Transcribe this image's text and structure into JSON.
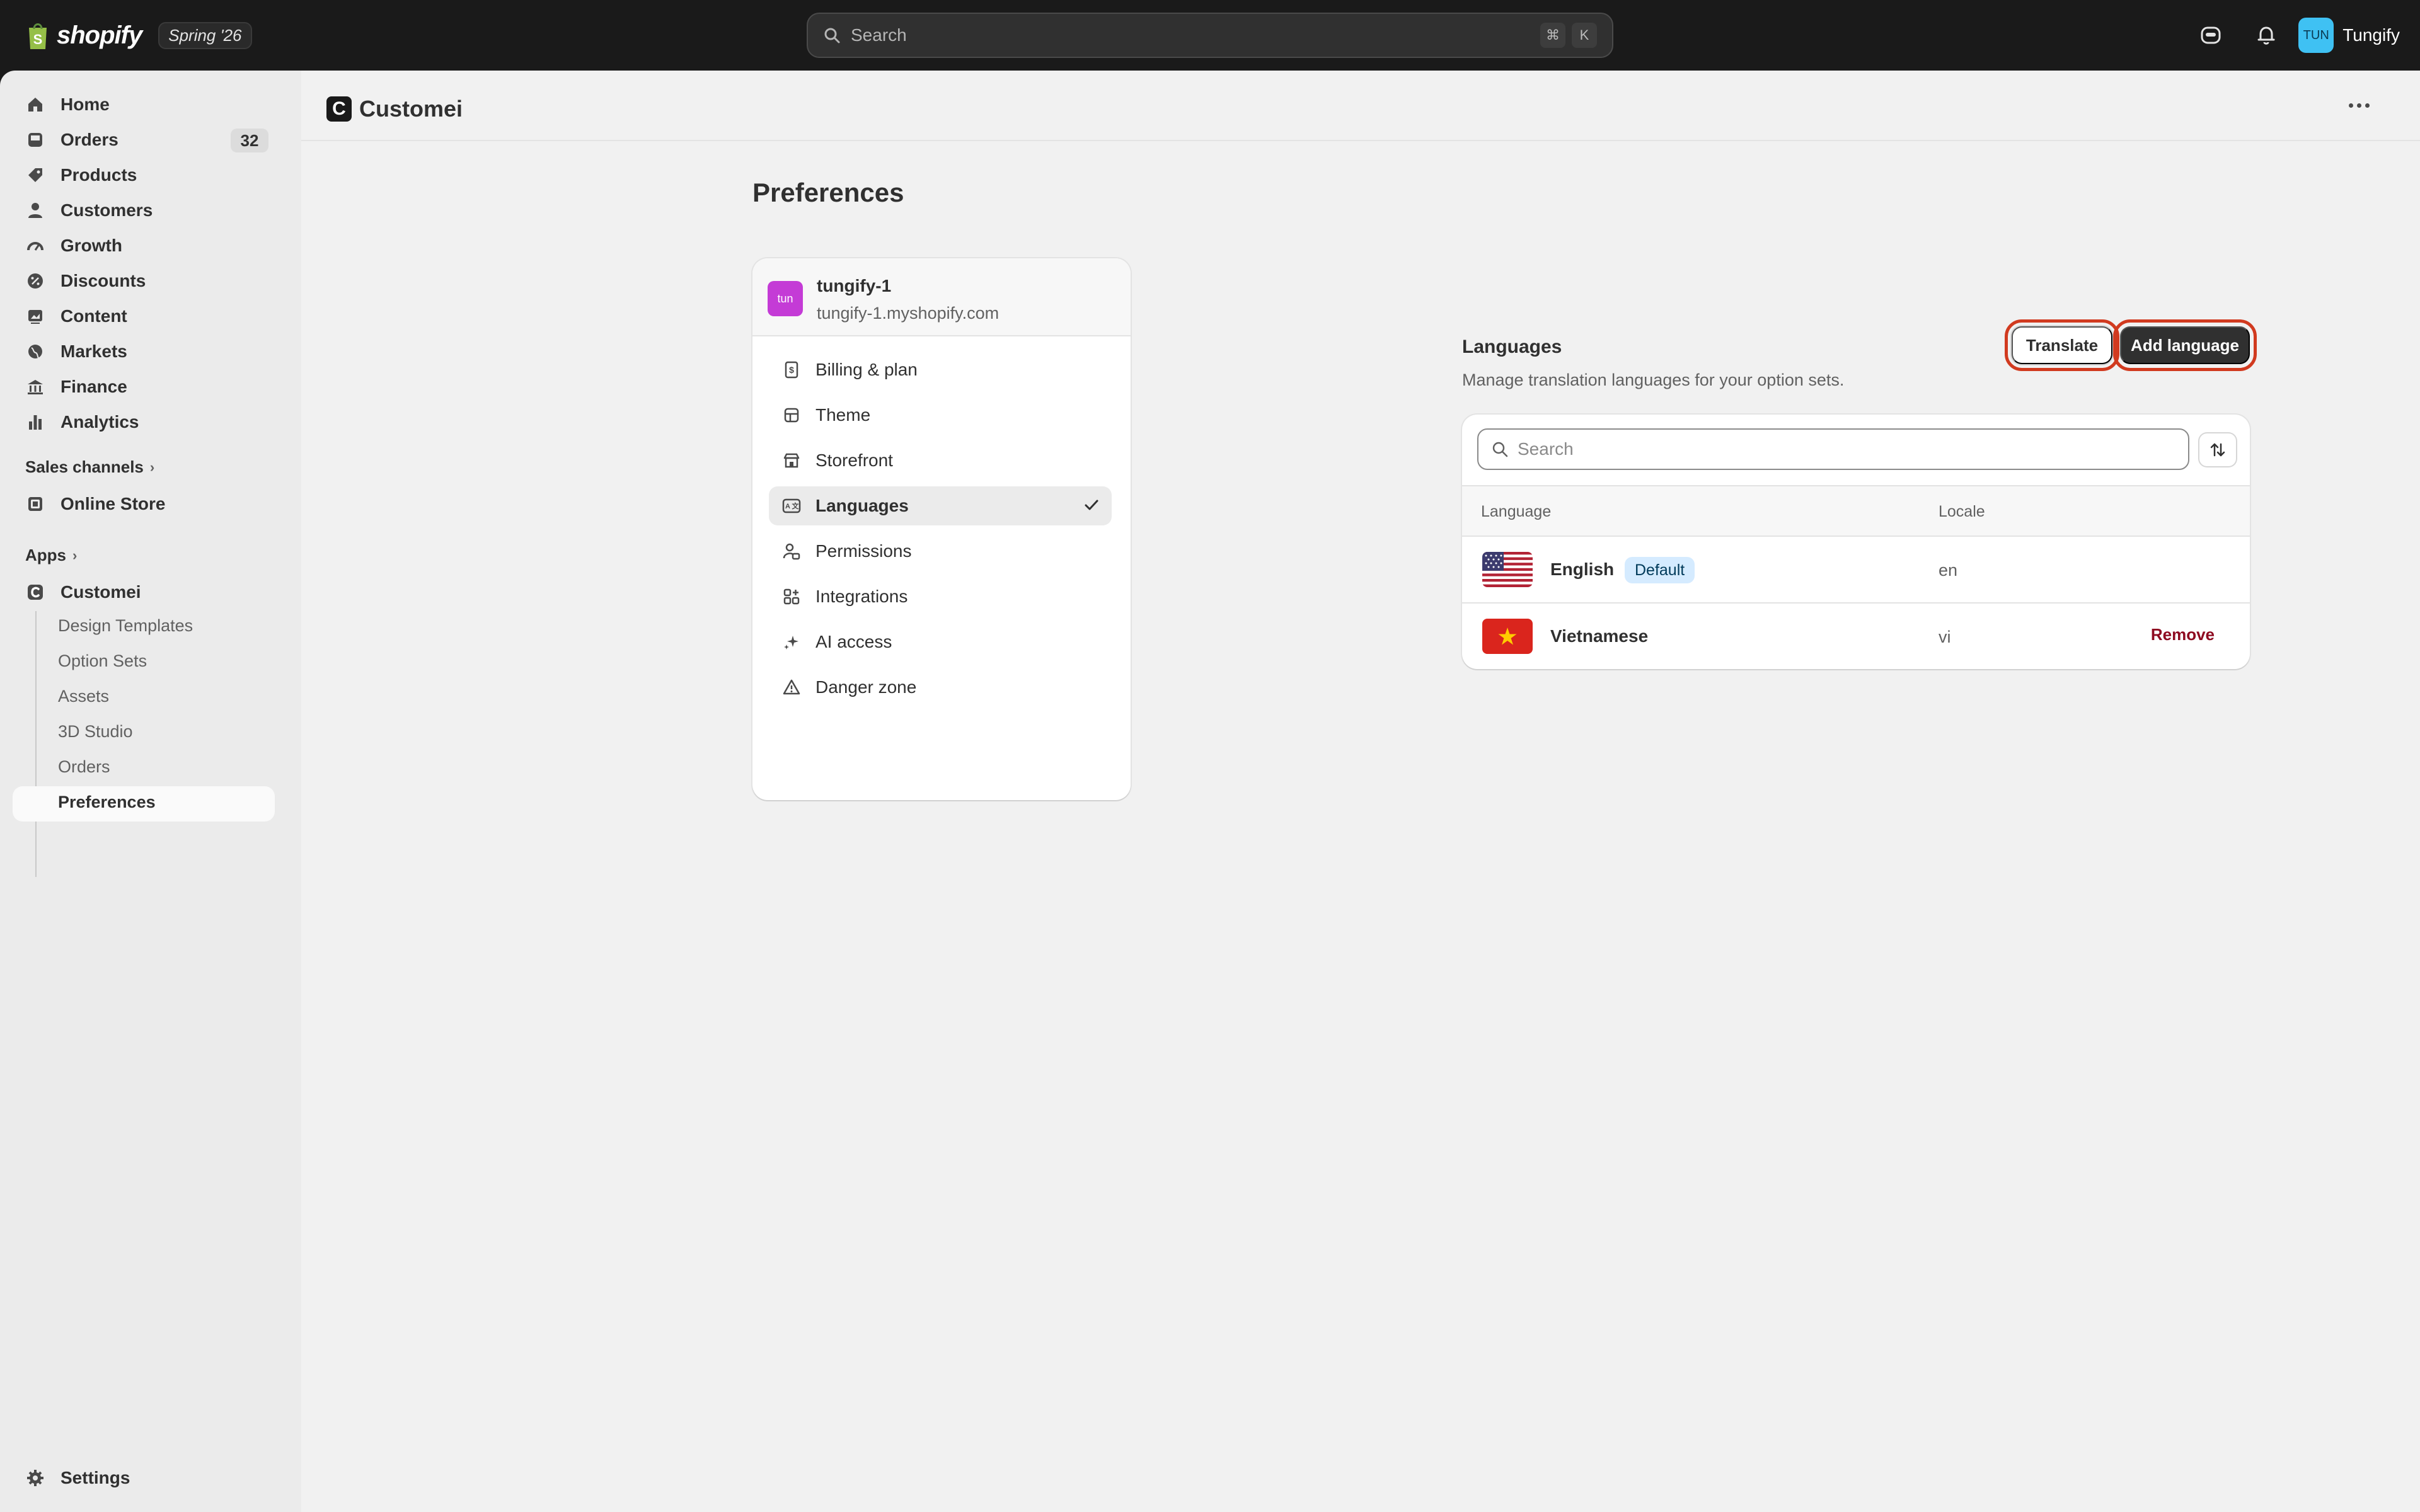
{
  "topbar": {
    "brand": "shopify",
    "edition": "Spring '26",
    "search_placeholder": "Search",
    "shortcut_cmd": "⌘",
    "shortcut_key": "K",
    "user_initials": "TUN",
    "user_name": "Tungify"
  },
  "sidebar": {
    "items": [
      {
        "label": "Home",
        "icon": "home-icon"
      },
      {
        "label": "Orders",
        "icon": "inbox-icon",
        "badge": "32"
      },
      {
        "label": "Products",
        "icon": "tag-icon"
      },
      {
        "label": "Customers",
        "icon": "person-icon"
      },
      {
        "label": "Growth",
        "icon": "gauge-icon"
      },
      {
        "label": "Discounts",
        "icon": "discount-icon"
      },
      {
        "label": "Content",
        "icon": "image-icon"
      },
      {
        "label": "Markets",
        "icon": "globe-icon"
      },
      {
        "label": "Finance",
        "icon": "bank-icon"
      },
      {
        "label": "Analytics",
        "icon": "bar-chart-icon"
      }
    ],
    "sales_channels_label": "Sales channels",
    "online_store_label": "Online Store",
    "apps_label": "Apps",
    "app_name": "Customei",
    "app_sub_items": [
      "Design Templates",
      "Option Sets",
      "Assets",
      "3D Studio",
      "Orders",
      "Preferences"
    ],
    "settings_label": "Settings"
  },
  "main": {
    "app_title": "Customei",
    "app_logo_letter": "C",
    "page_title": "Preferences",
    "store": {
      "avatar_text": "tun",
      "name": "tungify-1",
      "url": "tungify-1.myshopify.com"
    },
    "menu": [
      {
        "label": "Billing & plan",
        "icon": "receipt-icon"
      },
      {
        "label": "Theme",
        "icon": "theme-icon"
      },
      {
        "label": "Storefront",
        "icon": "store-icon"
      },
      {
        "label": "Languages",
        "icon": "language-icon",
        "active": true
      },
      {
        "label": "Permissions",
        "icon": "person-lock-icon"
      },
      {
        "label": "Integrations",
        "icon": "apps-icon"
      },
      {
        "label": "AI access",
        "icon": "sparkle-icon"
      },
      {
        "label": "Danger zone",
        "icon": "alert-triangle-icon"
      }
    ],
    "languages": {
      "title": "Languages",
      "description": "Manage translation languages for your option sets.",
      "translate_label": "Translate",
      "add_label": "Add language",
      "search_placeholder": "Search",
      "col_language": "Language",
      "col_locale": "Locale",
      "rows": [
        {
          "name": "English",
          "badge": "Default",
          "locale": "en",
          "flag": "us-flag"
        },
        {
          "name": "Vietnamese",
          "locale": "vi",
          "action": "Remove",
          "flag": "vn-flag"
        }
      ]
    }
  },
  "colors": {
    "highlight_outline": "#d13a1f",
    "primary_button": "#303030",
    "remove_text": "#8e0b21",
    "default_badge_bg": "#d5ebff",
    "store_avatar": "#c43bd6",
    "user_avatar": "#3fc1f3"
  }
}
